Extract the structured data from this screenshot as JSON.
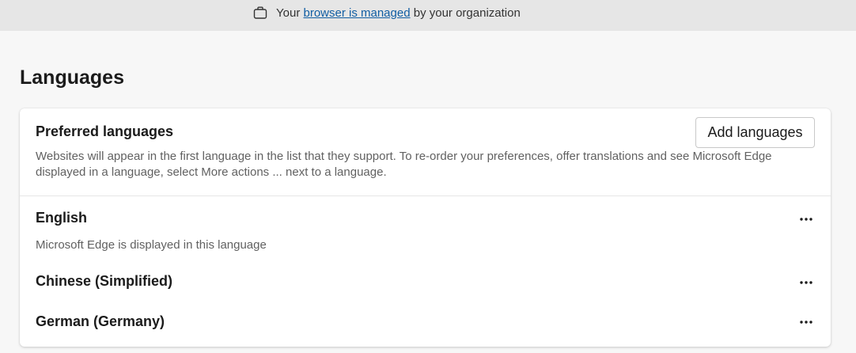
{
  "banner": {
    "text_before": "Your",
    "link_text": "browser is managed",
    "text_after": "by your organization",
    "icon": "briefcase-icon"
  },
  "page": {
    "title": "Languages"
  },
  "preferred": {
    "title": "Preferred languages",
    "description": "Websites will appear in the first language in the list that they support. To re-order your preferences, offer translations and see Microsoft Edge displayed in a language, select More actions ... next to a language.",
    "add_button_label": "Add languages"
  },
  "languages": [
    {
      "name": "English",
      "subtitle": "Microsoft Edge is displayed in this language",
      "more_icon": "more-actions-icon"
    },
    {
      "name": "Chinese (Simplified)",
      "more_icon": "more-actions-icon"
    },
    {
      "name": "German (Germany)",
      "more_icon": "more-actions-icon"
    }
  ],
  "colors": {
    "banner_bg": "#e6e6e6",
    "page_bg": "#f7f7f7",
    "link": "#115ea3",
    "secondary_text": "#616161"
  }
}
